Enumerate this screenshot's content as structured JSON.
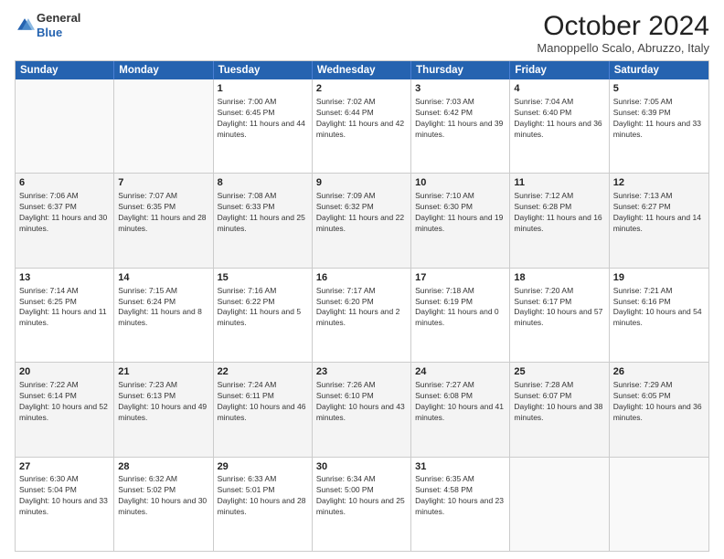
{
  "header": {
    "logo_line1": "General",
    "logo_line2": "Blue",
    "month": "October 2024",
    "location": "Manoppello Scalo, Abruzzo, Italy"
  },
  "days": [
    "Sunday",
    "Monday",
    "Tuesday",
    "Wednesday",
    "Thursday",
    "Friday",
    "Saturday"
  ],
  "weeks": [
    [
      {
        "num": "",
        "sunrise": "",
        "sunset": "",
        "daylight": ""
      },
      {
        "num": "",
        "sunrise": "",
        "sunset": "",
        "daylight": ""
      },
      {
        "num": "1",
        "sunrise": "Sunrise: 7:00 AM",
        "sunset": "Sunset: 6:45 PM",
        "daylight": "Daylight: 11 hours and 44 minutes."
      },
      {
        "num": "2",
        "sunrise": "Sunrise: 7:02 AM",
        "sunset": "Sunset: 6:44 PM",
        "daylight": "Daylight: 11 hours and 42 minutes."
      },
      {
        "num": "3",
        "sunrise": "Sunrise: 7:03 AM",
        "sunset": "Sunset: 6:42 PM",
        "daylight": "Daylight: 11 hours and 39 minutes."
      },
      {
        "num": "4",
        "sunrise": "Sunrise: 7:04 AM",
        "sunset": "Sunset: 6:40 PM",
        "daylight": "Daylight: 11 hours and 36 minutes."
      },
      {
        "num": "5",
        "sunrise": "Sunrise: 7:05 AM",
        "sunset": "Sunset: 6:39 PM",
        "daylight": "Daylight: 11 hours and 33 minutes."
      }
    ],
    [
      {
        "num": "6",
        "sunrise": "Sunrise: 7:06 AM",
        "sunset": "Sunset: 6:37 PM",
        "daylight": "Daylight: 11 hours and 30 minutes."
      },
      {
        "num": "7",
        "sunrise": "Sunrise: 7:07 AM",
        "sunset": "Sunset: 6:35 PM",
        "daylight": "Daylight: 11 hours and 28 minutes."
      },
      {
        "num": "8",
        "sunrise": "Sunrise: 7:08 AM",
        "sunset": "Sunset: 6:33 PM",
        "daylight": "Daylight: 11 hours and 25 minutes."
      },
      {
        "num": "9",
        "sunrise": "Sunrise: 7:09 AM",
        "sunset": "Sunset: 6:32 PM",
        "daylight": "Daylight: 11 hours and 22 minutes."
      },
      {
        "num": "10",
        "sunrise": "Sunrise: 7:10 AM",
        "sunset": "Sunset: 6:30 PM",
        "daylight": "Daylight: 11 hours and 19 minutes."
      },
      {
        "num": "11",
        "sunrise": "Sunrise: 7:12 AM",
        "sunset": "Sunset: 6:28 PM",
        "daylight": "Daylight: 11 hours and 16 minutes."
      },
      {
        "num": "12",
        "sunrise": "Sunrise: 7:13 AM",
        "sunset": "Sunset: 6:27 PM",
        "daylight": "Daylight: 11 hours and 14 minutes."
      }
    ],
    [
      {
        "num": "13",
        "sunrise": "Sunrise: 7:14 AM",
        "sunset": "Sunset: 6:25 PM",
        "daylight": "Daylight: 11 hours and 11 minutes."
      },
      {
        "num": "14",
        "sunrise": "Sunrise: 7:15 AM",
        "sunset": "Sunset: 6:24 PM",
        "daylight": "Daylight: 11 hours and 8 minutes."
      },
      {
        "num": "15",
        "sunrise": "Sunrise: 7:16 AM",
        "sunset": "Sunset: 6:22 PM",
        "daylight": "Daylight: 11 hours and 5 minutes."
      },
      {
        "num": "16",
        "sunrise": "Sunrise: 7:17 AM",
        "sunset": "Sunset: 6:20 PM",
        "daylight": "Daylight: 11 hours and 2 minutes."
      },
      {
        "num": "17",
        "sunrise": "Sunrise: 7:18 AM",
        "sunset": "Sunset: 6:19 PM",
        "daylight": "Daylight: 11 hours and 0 minutes."
      },
      {
        "num": "18",
        "sunrise": "Sunrise: 7:20 AM",
        "sunset": "Sunset: 6:17 PM",
        "daylight": "Daylight: 10 hours and 57 minutes."
      },
      {
        "num": "19",
        "sunrise": "Sunrise: 7:21 AM",
        "sunset": "Sunset: 6:16 PM",
        "daylight": "Daylight: 10 hours and 54 minutes."
      }
    ],
    [
      {
        "num": "20",
        "sunrise": "Sunrise: 7:22 AM",
        "sunset": "Sunset: 6:14 PM",
        "daylight": "Daylight: 10 hours and 52 minutes."
      },
      {
        "num": "21",
        "sunrise": "Sunrise: 7:23 AM",
        "sunset": "Sunset: 6:13 PM",
        "daylight": "Daylight: 10 hours and 49 minutes."
      },
      {
        "num": "22",
        "sunrise": "Sunrise: 7:24 AM",
        "sunset": "Sunset: 6:11 PM",
        "daylight": "Daylight: 10 hours and 46 minutes."
      },
      {
        "num": "23",
        "sunrise": "Sunrise: 7:26 AM",
        "sunset": "Sunset: 6:10 PM",
        "daylight": "Daylight: 10 hours and 43 minutes."
      },
      {
        "num": "24",
        "sunrise": "Sunrise: 7:27 AM",
        "sunset": "Sunset: 6:08 PM",
        "daylight": "Daylight: 10 hours and 41 minutes."
      },
      {
        "num": "25",
        "sunrise": "Sunrise: 7:28 AM",
        "sunset": "Sunset: 6:07 PM",
        "daylight": "Daylight: 10 hours and 38 minutes."
      },
      {
        "num": "26",
        "sunrise": "Sunrise: 7:29 AM",
        "sunset": "Sunset: 6:05 PM",
        "daylight": "Daylight: 10 hours and 36 minutes."
      }
    ],
    [
      {
        "num": "27",
        "sunrise": "Sunrise: 6:30 AM",
        "sunset": "Sunset: 5:04 PM",
        "daylight": "Daylight: 10 hours and 33 minutes."
      },
      {
        "num": "28",
        "sunrise": "Sunrise: 6:32 AM",
        "sunset": "Sunset: 5:02 PM",
        "daylight": "Daylight: 10 hours and 30 minutes."
      },
      {
        "num": "29",
        "sunrise": "Sunrise: 6:33 AM",
        "sunset": "Sunset: 5:01 PM",
        "daylight": "Daylight: 10 hours and 28 minutes."
      },
      {
        "num": "30",
        "sunrise": "Sunrise: 6:34 AM",
        "sunset": "Sunset: 5:00 PM",
        "daylight": "Daylight: 10 hours and 25 minutes."
      },
      {
        "num": "31",
        "sunrise": "Sunrise: 6:35 AM",
        "sunset": "Sunset: 4:58 PM",
        "daylight": "Daylight: 10 hours and 23 minutes."
      },
      {
        "num": "",
        "sunrise": "",
        "sunset": "",
        "daylight": ""
      },
      {
        "num": "",
        "sunrise": "",
        "sunset": "",
        "daylight": ""
      }
    ]
  ]
}
